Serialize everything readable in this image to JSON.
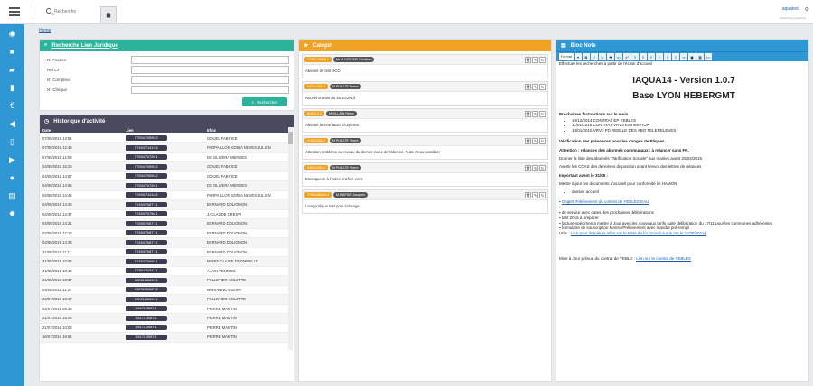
{
  "topbar": {
    "search_placeholder": "Recherche",
    "user": "aquatest",
    "user_sub": "Powered by Aquarius"
  },
  "breadcrumb": "Home",
  "search_panel": {
    "title": "Recherche Lien Juridique",
    "fields": [
      "N° Facture",
      "Ref LJ",
      "N° Compteur",
      "N° Chèque"
    ],
    "button": "Rechercher"
  },
  "history_panel": {
    "title": "Historique d'activité",
    "columns": [
      "Date",
      "Lien",
      "Infos"
    ],
    "rows": [
      {
        "date": "07/09/2015 13:54",
        "lien": "77534.70595.2",
        "info": "GOUEL FABRICE"
      },
      {
        "date": "07/09/2015 12:46",
        "lien": "77493.71413.5",
        "info": "PARPAILLON SONIA NEVES JULIEN"
      },
      {
        "date": "07/09/2015 12:08",
        "lien": "77534.70720.1",
        "info": "DE OLIVERA MENDES"
      },
      {
        "date": "04/09/2015 15:26",
        "lien": "77534.70595.2",
        "info": "GOUEL FABRICE"
      },
      {
        "date": "04/09/2015 14:57",
        "lien": "77534.70595.2",
        "info": "GOUEL FABRICE"
      },
      {
        "date": "04/09/2015 14:55",
        "lien": "77534.70720.1",
        "info": "DE OLIVERA MENDES"
      },
      {
        "date": "04/09/2015 14:46",
        "lien": "77493.71413.5",
        "info": "PARPAILLON SONIA NEVES JULIEN"
      },
      {
        "date": "04/09/2015 14:38",
        "lien": "77493.70877.1",
        "info": "BERNARD DOLIGNON"
      },
      {
        "date": "04/09/2015 14:37",
        "lien": "77493.70790.1",
        "info": "J. CLAUDE CRESPI"
      },
      {
        "date": "04/09/2015 14:21",
        "lien": "77493.70877.1",
        "info": "BERNARD DOLIGNON"
      },
      {
        "date": "02/09/2015 17:18",
        "lien": "77493.70877.1",
        "info": "BERNARD DOLIGNON"
      },
      {
        "date": "02/09/2015 14:38",
        "lien": "77493.70877.1",
        "info": "BERNARD DOLIGNON"
      },
      {
        "date": "31/08/2015 11:11",
        "lien": "77493.70877.1",
        "info": "BERNARD DOLIGNON"
      },
      {
        "date": "31/08/2015 10:58",
        "lien": "77493.70865.1",
        "info": "MARIE CLAIRE DROMNELLE"
      },
      {
        "date": "31/08/2015 10:48",
        "lien": "77504.70311.1",
        "info": "ALAIN VENRIES"
      },
      {
        "date": "31/08/2015 10:37",
        "lien": "28051.88892.1",
        "info": "PELLETIER COLETTE"
      },
      {
        "date": "04/08/2015 11:27",
        "lien": "81292.86867.2",
        "info": "MARIANNE GULIPA"
      },
      {
        "date": "22/07/2015 10:17",
        "lien": "28051.88892.1",
        "info": "PELLETIER COLETTE"
      },
      {
        "date": "22/07/2015 08:38",
        "lien": "34172.3587.1",
        "info": "PIERRE MARTIN"
      },
      {
        "date": "21/07/2015 15:08",
        "lien": "34172.3587.1",
        "info": "PIERRE MARTIN"
      },
      {
        "date": "21/07/2015 10:06",
        "lien": "34172.3587.1",
        "info": "PIERRE MARTIN"
      },
      {
        "date": "16/07/2015 16:54",
        "lien": "34172.3587.1",
        "info": "PIERRE MARTIN"
      }
    ]
  },
  "calepin": {
    "title": "Calepin",
    "notes": [
      {
        "ref": "77534.70595.1",
        "who": "Mr M LEROND Christian",
        "text": "Abonné de test HCO"
      },
      {
        "ref": "04204.826.1",
        "who": "M PIJALTE Pierre",
        "text": "Nouvel entrant du 18/10/2014"
      },
      {
        "ref": "81003.3.1",
        "who": "M VILLAIN Rémy",
        "text": "Abonné à recontacter d'urgence"
      },
      {
        "ref": "01003.826.1",
        "who": "M PIJALTE Pierre",
        "text": "Attention problème au niveau du dernier index de l'abonné. Fuite d'eau possible!"
      },
      {
        "ref": "04204.826.1",
        "who": "M PIJALTE Pierre",
        "text": "Escroquerie à l'index, méfiez vous"
      },
      {
        "ref": "77504.86419.1",
        "who": "M MAPIAS Jacques",
        "text": "Lien juridique test pour échange"
      }
    ]
  },
  "bloc_note": {
    "title": "Bloc Note",
    "format_label": "Format",
    "intro": "Effectuer les recherches à partir de l'écran d'accueil",
    "heading1": "IAQUA14 - Version 1.0.7",
    "heading2": "Base LYON HEBERGMT",
    "sub1": "Prochaines facturations sur le mois",
    "list1": [
      "19/12/2014 CONTRAT EP YEBLES",
      "11/01/2015 CONTRAT VRV3 ESTIMATION",
      "18/01/2015 VRV3 FD REELLE DES ABO TELERELEVES"
    ],
    "sub2": "Vérification des présences pour les congés de Pâques.",
    "attention": "Attention : relances des abonnés communaux : à relancer sans FR.",
    "l1": "Donner la liste des abonnés \"Tarification Sociale\" aux mairies avant 20/04/2015",
    "l2": "Avertir les CCAS des dernières disposition avant l'envoi des lettres de relances",
    "sub3": "Important avant le 31/05 :",
    "l3": "Mettre à jour les documents d'accueil pour conformité loi HAMON",
    "list2": [
      "dossier accueil"
    ],
    "link1": "Onglet Prélèvement du contrat de YEBLES EAU",
    "l4": "de service avec dates des prochaines délibérations",
    "l5": "tarif 2015 à préparer",
    "l6": "facture spécimen a mettre à Jour avec les nouveaux tarifs suite délibération du 17/11 pour les communes adhérentes",
    "l7": "formulaire de souscription Mensu/Prélèvement avec mandat pré-rempli",
    "l8": "Utile :",
    "link2": "Lien pour dernières infos sur le texte de loi (trouvé sur le net le 11/08/2014)",
    "l9": "Mise à Jour prévue du contrat de YEBLE :",
    "link3": "Lien sur le contrat de YEBLES"
  }
}
